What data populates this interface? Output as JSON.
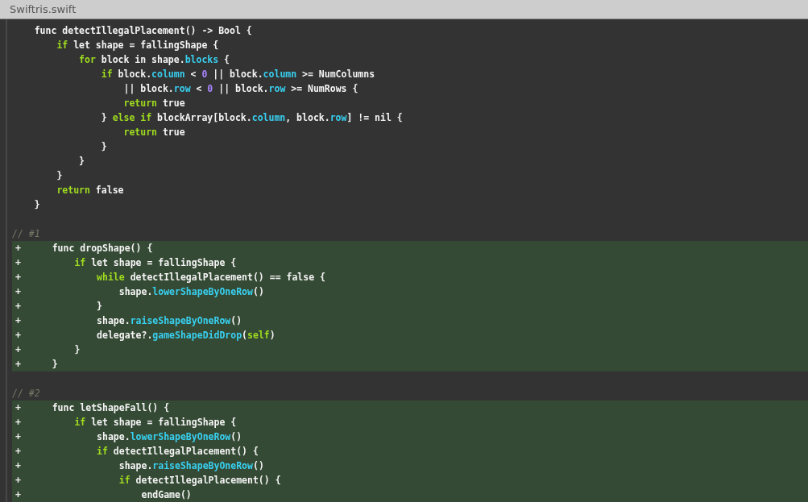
{
  "window": {
    "title": "Swiftris.swift"
  },
  "lines": [
    {
      "added": false,
      "tokens": [
        {
          "kind": "plain",
          "text": "    func detectIllegalPlacement() -> Bool {"
        }
      ]
    },
    {
      "added": false,
      "tokens": [
        {
          "kind": "keyword",
          "text": "        if"
        },
        {
          "kind": "plain",
          "text": " let shape = fallingShape {"
        }
      ]
    },
    {
      "added": false,
      "tokens": [
        {
          "kind": "keyword",
          "text": "            for"
        },
        {
          "kind": "plain",
          "text": " block in shape."
        },
        {
          "kind": "property",
          "text": "blocks"
        },
        {
          "kind": "plain",
          "text": " {"
        }
      ]
    },
    {
      "added": false,
      "tokens": [
        {
          "kind": "keyword",
          "text": "                if"
        },
        {
          "kind": "plain",
          "text": " block."
        },
        {
          "kind": "property",
          "text": "column"
        },
        {
          "kind": "plain",
          "text": " < "
        },
        {
          "kind": "number",
          "text": "0"
        },
        {
          "kind": "plain",
          "text": " || block."
        },
        {
          "kind": "property",
          "text": "column"
        },
        {
          "kind": "plain",
          "text": " >= NumColumns"
        }
      ]
    },
    {
      "added": false,
      "tokens": [
        {
          "kind": "plain",
          "text": "                    || block."
        },
        {
          "kind": "property",
          "text": "row"
        },
        {
          "kind": "plain",
          "text": " < "
        },
        {
          "kind": "number",
          "text": "0"
        },
        {
          "kind": "plain",
          "text": " || block."
        },
        {
          "kind": "property",
          "text": "row"
        },
        {
          "kind": "plain",
          "text": " >= NumRows {"
        }
      ]
    },
    {
      "added": false,
      "tokens": [
        {
          "kind": "keyword",
          "text": "                    return"
        },
        {
          "kind": "plain",
          "text": " true"
        }
      ]
    },
    {
      "added": false,
      "tokens": [
        {
          "kind": "plain",
          "text": "                } "
        },
        {
          "kind": "keyword",
          "text": "else if"
        },
        {
          "kind": "plain",
          "text": " blockArray[block."
        },
        {
          "kind": "property",
          "text": "column"
        },
        {
          "kind": "plain",
          "text": ", block."
        },
        {
          "kind": "property",
          "text": "row"
        },
        {
          "kind": "plain",
          "text": "] != nil {"
        }
      ]
    },
    {
      "added": false,
      "tokens": [
        {
          "kind": "keyword",
          "text": "                    return"
        },
        {
          "kind": "plain",
          "text": " true"
        }
      ]
    },
    {
      "added": false,
      "tokens": [
        {
          "kind": "plain",
          "text": "                }"
        }
      ]
    },
    {
      "added": false,
      "tokens": [
        {
          "kind": "plain",
          "text": "            }"
        }
      ]
    },
    {
      "added": false,
      "tokens": [
        {
          "kind": "plain",
          "text": "        }"
        }
      ]
    },
    {
      "added": false,
      "tokens": [
        {
          "kind": "keyword",
          "text": "        return"
        },
        {
          "kind": "plain",
          "text": " false"
        }
      ]
    },
    {
      "added": false,
      "tokens": [
        {
          "kind": "plain",
          "text": "    }"
        }
      ]
    },
    {
      "added": false
    },
    {
      "added": false,
      "tokens": [
        {
          "kind": "comment",
          "text": "// #1"
        }
      ]
    },
    {
      "added": true,
      "marker": "+",
      "tokens": [
        {
          "kind": "plain",
          "text": "    func dropShape() {"
        }
      ]
    },
    {
      "added": true,
      "marker": "+",
      "tokens": [
        {
          "kind": "keyword",
          "text": "        if"
        },
        {
          "kind": "plain",
          "text": " let shape = fallingShape {"
        }
      ]
    },
    {
      "added": true,
      "marker": "+",
      "tokens": [
        {
          "kind": "keyword",
          "text": "            while"
        },
        {
          "kind": "plain",
          "text": " detectIllegalPlacement() == false {"
        }
      ]
    },
    {
      "added": true,
      "marker": "+",
      "tokens": [
        {
          "kind": "plain",
          "text": "                shape."
        },
        {
          "kind": "property",
          "text": "lowerShapeByOneRow"
        },
        {
          "kind": "plain",
          "text": "()"
        }
      ]
    },
    {
      "added": true,
      "marker": "+",
      "tokens": [
        {
          "kind": "plain",
          "text": "            }"
        }
      ]
    },
    {
      "added": true,
      "marker": "+",
      "tokens": [
        {
          "kind": "plain",
          "text": "            shape."
        },
        {
          "kind": "property",
          "text": "raiseShapeByOneRow"
        },
        {
          "kind": "plain",
          "text": "()"
        }
      ]
    },
    {
      "added": true,
      "marker": "+",
      "tokens": [
        {
          "kind": "plain",
          "text": "            delegate?."
        },
        {
          "kind": "property",
          "text": "gameShapeDidDrop"
        },
        {
          "kind": "plain",
          "text": "("
        },
        {
          "kind": "keyword",
          "text": "self"
        },
        {
          "kind": "plain",
          "text": ")"
        }
      ]
    },
    {
      "added": true,
      "marker": "+",
      "tokens": [
        {
          "kind": "plain",
          "text": "        }"
        }
      ]
    },
    {
      "added": true,
      "marker": "+",
      "tokens": [
        {
          "kind": "plain",
          "text": "    }"
        }
      ]
    },
    {
      "added": false
    },
    {
      "added": false,
      "tokens": [
        {
          "kind": "comment",
          "text": "// #2"
        }
      ]
    },
    {
      "added": true,
      "marker": "+",
      "tokens": [
        {
          "kind": "plain",
          "text": "    func letShapeFall() {"
        }
      ]
    },
    {
      "added": true,
      "marker": "+",
      "tokens": [
        {
          "kind": "keyword",
          "text": "        if"
        },
        {
          "kind": "plain",
          "text": " let shape = fallingShape {"
        }
      ]
    },
    {
      "added": true,
      "marker": "+",
      "tokens": [
        {
          "kind": "plain",
          "text": "            shape."
        },
        {
          "kind": "property",
          "text": "lowerShapeByOneRow"
        },
        {
          "kind": "plain",
          "text": "()"
        }
      ]
    },
    {
      "added": true,
      "marker": "+",
      "tokens": [
        {
          "kind": "keyword",
          "text": "            if"
        },
        {
          "kind": "plain",
          "text": " detectIllegalPlacement() {"
        }
      ]
    },
    {
      "added": true,
      "marker": "+",
      "tokens": [
        {
          "kind": "plain",
          "text": "                shape."
        },
        {
          "kind": "property",
          "text": "raiseShapeByOneRow"
        },
        {
          "kind": "plain",
          "text": "()"
        }
      ]
    },
    {
      "added": true,
      "marker": "+",
      "tokens": [
        {
          "kind": "keyword",
          "text": "                if"
        },
        {
          "kind": "plain",
          "text": " detectIllegalPlacement() {"
        }
      ]
    },
    {
      "added": true,
      "marker": "+",
      "tokens": [
        {
          "kind": "plain",
          "text": "                    endGame()"
        }
      ]
    }
  ]
}
